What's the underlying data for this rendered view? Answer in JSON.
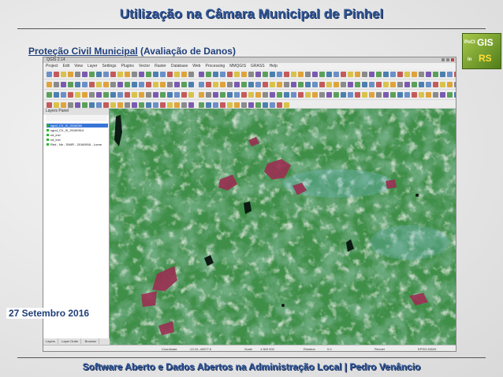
{
  "slide": {
    "title": "Utilização na Câmara Municipal de Pinhel",
    "subtitle_link": "Proteção Civil Municipal",
    "subtitle_rest": "(Avaliação de Danos)",
    "date": "27 Setembro 2016",
    "footer": "Software Aberto e Dados Abertos na Administração Local | Pedro Venâncio",
    "logo": {
      "top": "GIS",
      "bottom": "RS",
      "small_top": "PoCI",
      "small_bottom": "In"
    }
  },
  "qgis": {
    "window_title": "QGIS 2.14",
    "menu": [
      "Project",
      "Edit",
      "View",
      "Layer",
      "Settings",
      "Plugins",
      "Vector",
      "Raster",
      "Database",
      "Web",
      "Processing",
      "MMQGIS",
      "GRASS",
      "Help"
    ],
    "layers_panel_title": "Layers Panel",
    "layers": [
      {
        "name": "vgnd_CX_Xl_2016090",
        "selected": true
      },
      {
        "name": "vgnd_CX_Xl_20160914",
        "selected": false
      },
      {
        "name": "vd_inxl",
        "selected": false
      },
      {
        "name": "vd_inxl",
        "selected": false
      },
      {
        "name": "Red - Nir - SWIR - 20160916 - Lume",
        "selected": false
      }
    ],
    "panel_tabs": [
      "Layers",
      "Layer Order",
      "Browser"
    ],
    "status": {
      "coordinate_label": "Coordinate",
      "coordinate": "-13.10.-40577.6",
      "scale_label": "Scale",
      "scale": "1:300 000",
      "rotation_label": "Rotation",
      "rotation": "0.0",
      "render_label": "Render",
      "crs": "EPSG:32629"
    }
  },
  "colors": {
    "title": "#2f5597",
    "accent": "#1f3f7a",
    "vegetation": "#2f7a3a",
    "burned": "#9a2f52"
  }
}
